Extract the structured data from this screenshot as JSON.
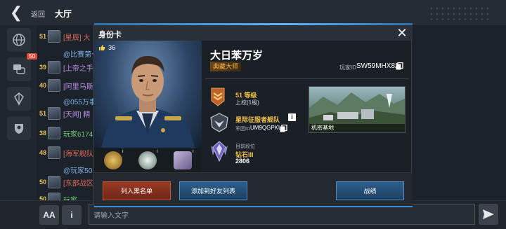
{
  "topbar": {
    "back_label": "返回",
    "hall_label": "大厅"
  },
  "rail": {
    "badge_count": "50"
  },
  "chat": {
    "rows": [
      {
        "level": "51",
        "name": "[星辰] 大",
        "color": "#e06a5a"
      },
      {
        "level": "",
        "name": "@比赛第一",
        "color": "#7fb0e6"
      },
      {
        "level": "39",
        "name": "[上帝之手",
        "color": "#b98de6"
      },
      {
        "level": "40",
        "name": "[阿里乌斯",
        "color": "#b98de6"
      },
      {
        "level": "",
        "name": "@055万事",
        "color": "#7fb0e6"
      },
      {
        "level": "51",
        "name": "[天闻] 精",
        "color": "#b98de6"
      },
      {
        "level": "38",
        "name": "玩家6174",
        "color": "#6ecb78"
      },
      {
        "level": "48",
        "name": "[海军舰队",
        "color": "#e06a5a"
      },
      {
        "level": "",
        "name": "@玩家50",
        "color": "#7fb0e6"
      },
      {
        "level": "50",
        "name": "[东部战区",
        "color": "#e06a5a"
      },
      {
        "level": "50",
        "name": "玩家",
        "color": "#6ecb78"
      }
    ]
  },
  "bottombar": {
    "font_label": "AA",
    "info_label": "i",
    "input_placeholder": "请输入文字"
  },
  "modal": {
    "title": "身份卡",
    "likes": "36",
    "player_name": "大日苯万岁",
    "title_tag": "典藏大师",
    "player_id_label": "玩家ID",
    "player_id": "SW59MHX82",
    "level": "51 等级",
    "rank_title": "上校(1级)",
    "fleet_name": "星际征服者舰队",
    "fleet_id_label": "军团ID",
    "fleet_id": "UM9QGPKU",
    "season_label": "目前段位",
    "season_rank": "钻石III",
    "season_score": "2806",
    "base_caption": "机密基地",
    "buttons": {
      "blacklist": "列入黑名单",
      "add_friend": "添加到好友列表",
      "record": "战绩"
    }
  },
  "colors": {
    "accent_blue": "#3a8fd6",
    "gold": "#f0c24b",
    "danger": "#9a3a26"
  }
}
